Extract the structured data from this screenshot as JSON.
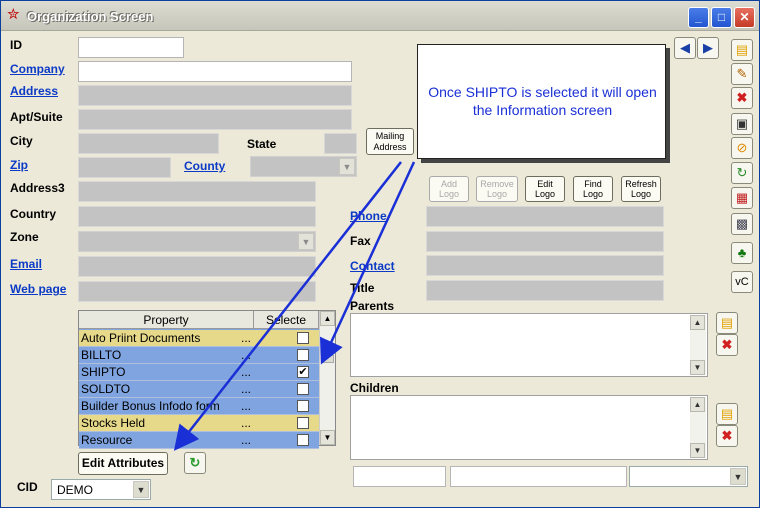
{
  "window": {
    "title": "Organization Screen",
    "min": "_",
    "max": "□",
    "close": "✕"
  },
  "labels": {
    "id": "ID",
    "apt": "Apt/Suite",
    "city": "City",
    "state": "State",
    "address3": "Address3",
    "country": "Country",
    "zone": "Zone",
    "fax": "Fax",
    "title": "Title",
    "parents": "Parents",
    "children": "Children",
    "cid": "CID"
  },
  "links": {
    "company": "Company",
    "address": "Address",
    "zip": "Zip",
    "county": "County",
    "email": "Email",
    "webpage": "Web page",
    "phone": "Phone",
    "contact": "Contact"
  },
  "buttons": {
    "mailing": "Mailing\nAddress",
    "add_logo": "Add\nLogo",
    "remove_logo": "Remove\nLogo",
    "edit_logo": "Edit\nLogo",
    "find_logo": "Find\nLogo",
    "refresh_logo": "Refresh\nLogo",
    "edit_attributes": "Edit Attributes",
    "vc": "vC"
  },
  "grid": {
    "headers": [
      "Property",
      "Selecte"
    ],
    "rows": [
      {
        "name": "Auto Priint Documents",
        "dots": "...",
        "checked": false,
        "highlight": true
      },
      {
        "name": "BILLTO",
        "dots": "...",
        "checked": false,
        "highlight": false
      },
      {
        "name": "SHIPTO",
        "dots": "...",
        "checked": true,
        "highlight": false
      },
      {
        "name": "SOLDTO",
        "dots": "...",
        "checked": false,
        "highlight": false
      },
      {
        "name": "Builder Bonus Infodo form",
        "dots": "...",
        "checked": false,
        "highlight": false
      },
      {
        "name": "Stocks Held",
        "dots": "...",
        "checked": false,
        "highlight": true
      },
      {
        "name": "Resource",
        "dots": "...",
        "checked": false,
        "highlight": false
      }
    ]
  },
  "cid_value": "DEMO",
  "callout": "Once SHIPTO is selected it will open the Information screen",
  "colors": {
    "link": "#0b3ac6",
    "callout_text": "#1a2fd6",
    "arrow": "#1a2fd6",
    "grid_row": "#7fa4e0",
    "grid_highlight": "#e6d98a"
  },
  "icons": {
    "app": "star-icon",
    "nav_prev": "triangle-left-icon",
    "nav_next": "triangle-right-icon"
  }
}
